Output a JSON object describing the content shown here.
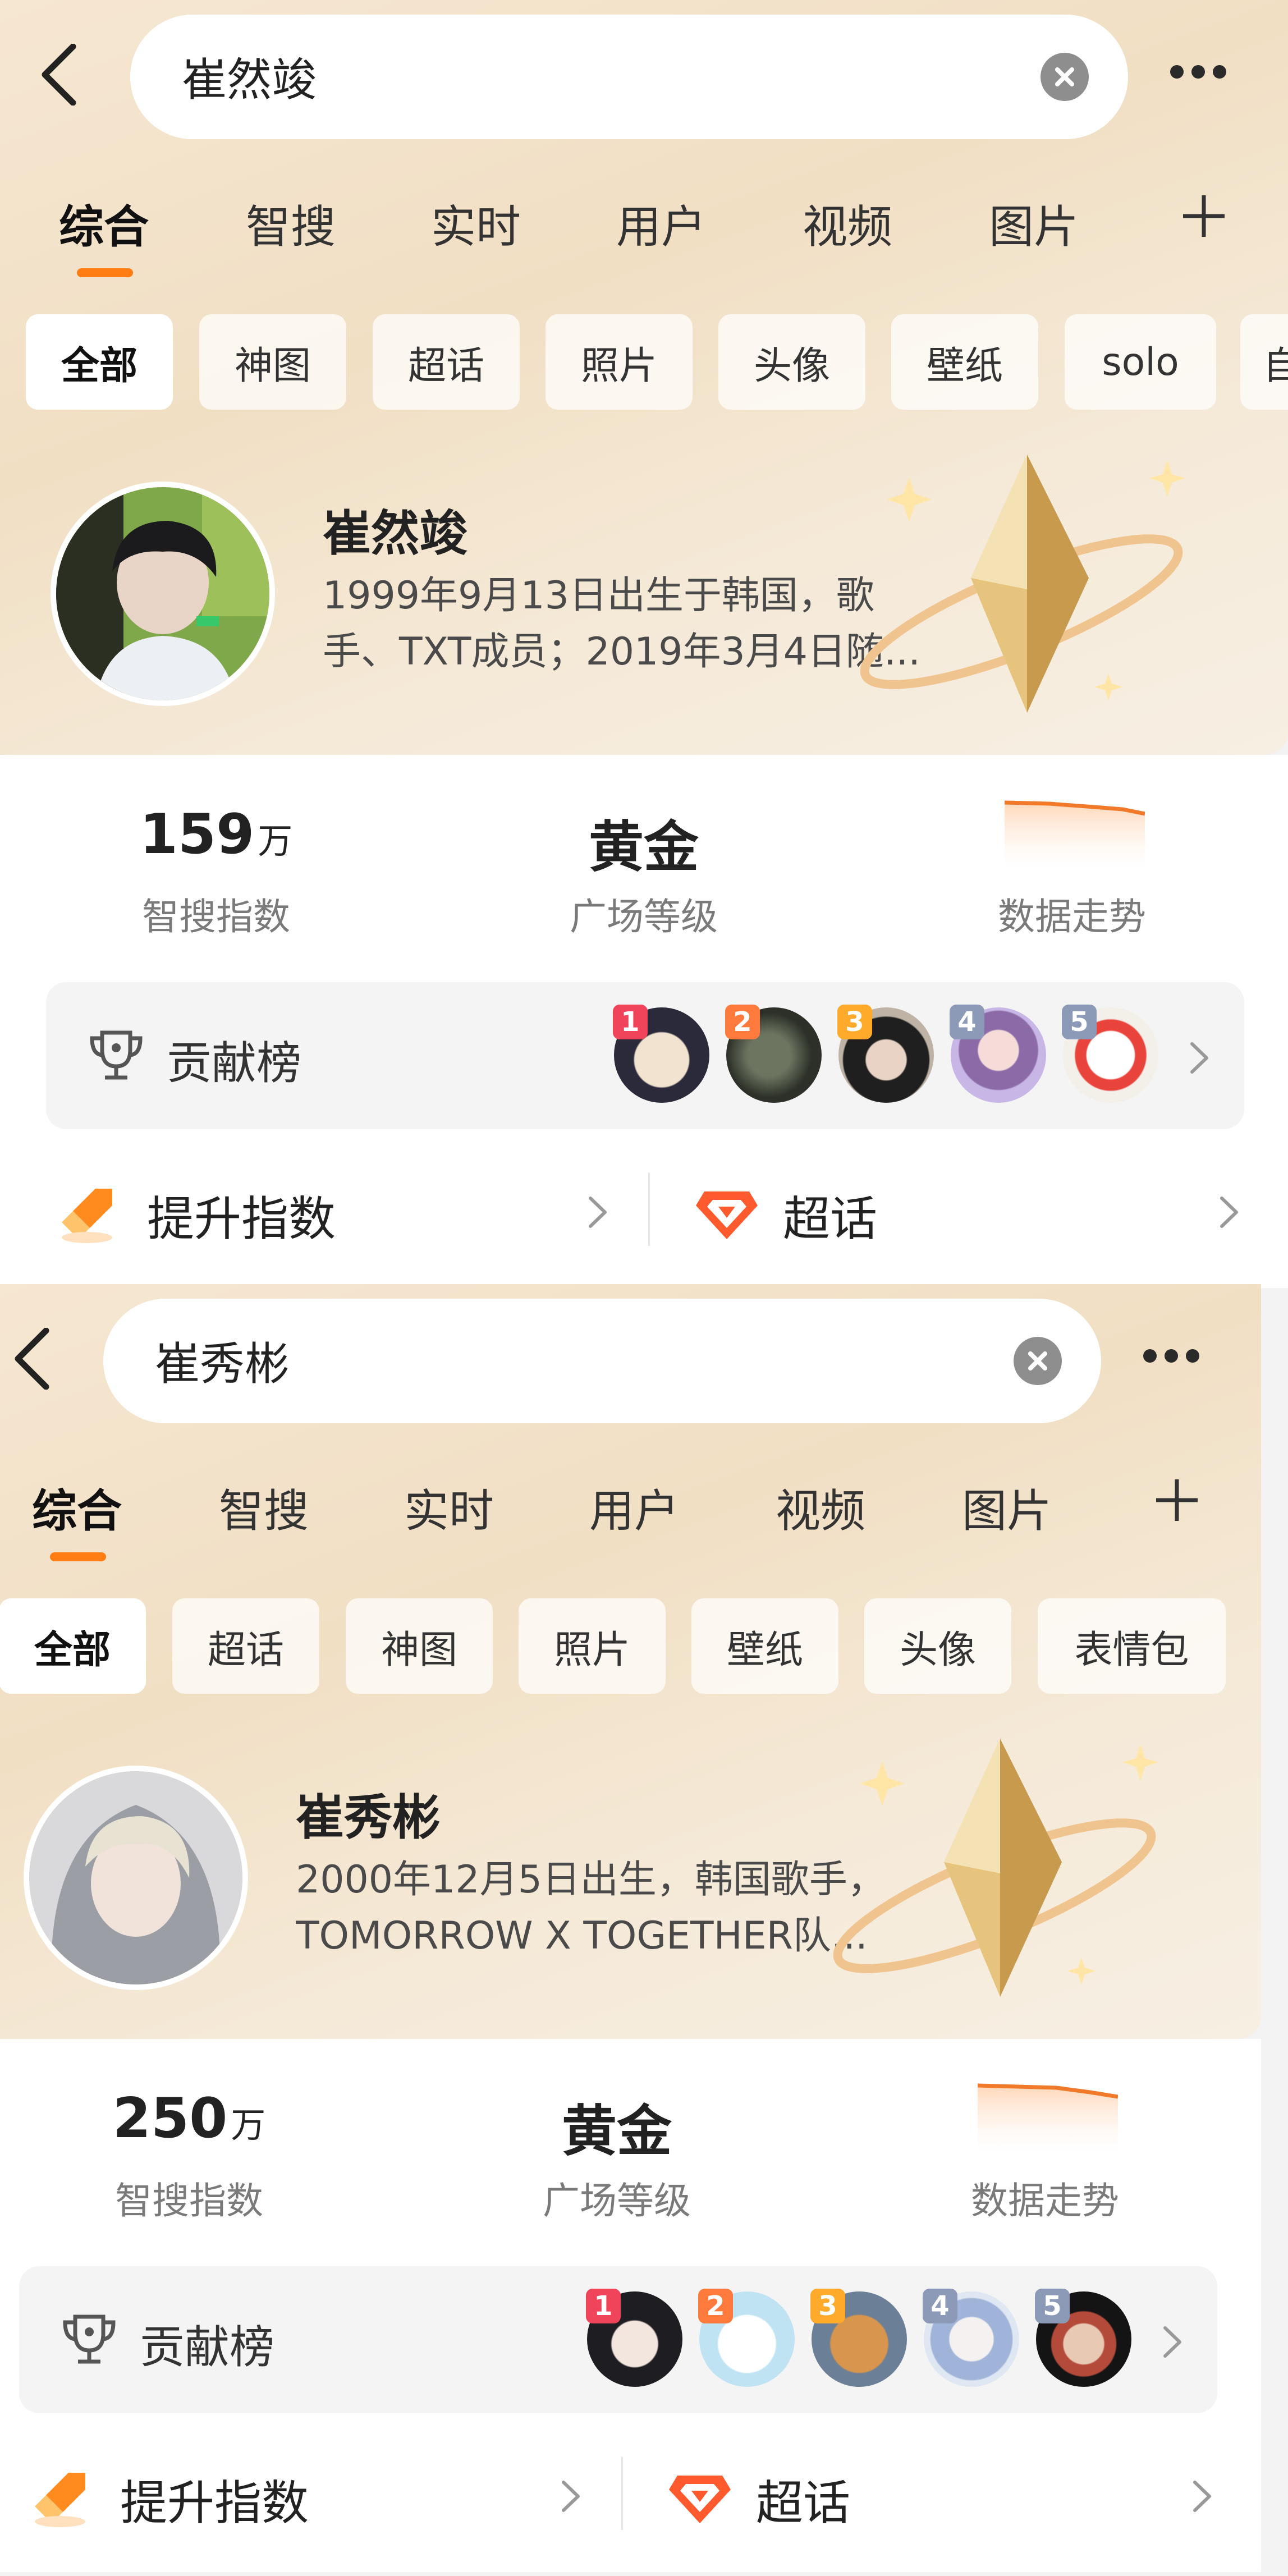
{
  "colors": {
    "accent": "#ff7d12",
    "hero_bg": "#f2e1c7",
    "text_dark": "#222222",
    "text_gray": "#7a7a7a"
  },
  "icons": [
    "back-arrow-icon",
    "clear-icon",
    "more-icon",
    "plus-icon",
    "trophy-icon",
    "chevron-right-icon",
    "rocket-icon",
    "diamond-icon",
    "crystal-badge-icon",
    "trend-line-icon"
  ],
  "screens": [
    {
      "search": {
        "query": "崔然竣"
      },
      "tabs": [
        "综合",
        "智搜",
        "实时",
        "用户",
        "视频",
        "图片"
      ],
      "active_tab": "综合",
      "chips": [
        "全部",
        "神图",
        "超话",
        "照片",
        "头像",
        "壁纸",
        "solo",
        "自"
      ],
      "profile": {
        "name": "崔然竣",
        "bio_line1": "1999年9月13日出生于韩国，歌",
        "bio_line2": "手、TXT成员；2019年3月4日随..."
      },
      "stats": {
        "index_value": "159",
        "index_unit": "万",
        "index_label": "智搜指数",
        "level_value": "黄金",
        "level_label": "广场等级",
        "trend_label": "数据走势"
      },
      "contribution": {
        "label": "贡献榜",
        "ranks": [
          "1",
          "2",
          "3",
          "4",
          "5"
        ]
      },
      "actions": {
        "boost": "提升指数",
        "topic": "超话"
      }
    },
    {
      "search": {
        "query": "崔秀彬"
      },
      "tabs": [
        "综合",
        "智搜",
        "实时",
        "用户",
        "视频",
        "图片"
      ],
      "active_tab": "综合",
      "chips": [
        "全部",
        "超话",
        "神图",
        "照片",
        "壁纸",
        "头像",
        "表情包"
      ],
      "profile": {
        "name": "崔秀彬",
        "bio_line1": "2000年12月5日出生，韩国歌手，",
        "bio_line2": "TOMORROW X TOGETHER队..."
      },
      "stats": {
        "index_value": "250",
        "index_unit": "万",
        "index_label": "智搜指数",
        "level_value": "黄金",
        "level_label": "广场等级",
        "trend_label": "数据走势"
      },
      "contribution": {
        "label": "贡献榜",
        "ranks": [
          "1",
          "2",
          "3",
          "4",
          "5"
        ]
      },
      "actions": {
        "boost": "提升指数",
        "topic": "超话"
      }
    }
  ]
}
